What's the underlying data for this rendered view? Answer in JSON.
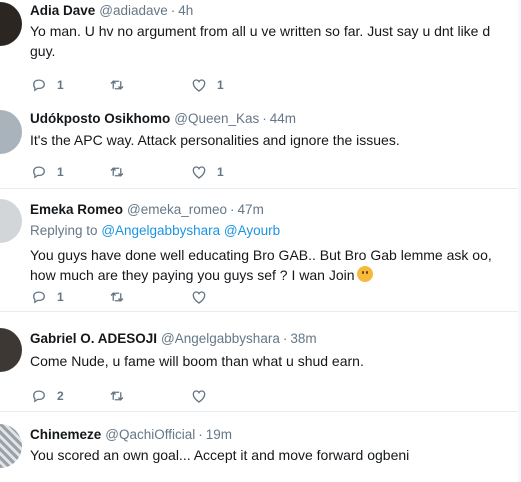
{
  "tweets": [
    {
      "name": "Adia Dave",
      "handle": "@adiadave",
      "time": "4h",
      "reply_label": "",
      "reply_mentions": [],
      "text": "Yo man.  U hv no argument from all u ve written so far. Just say u dnt like d guy.",
      "reply_count": "1",
      "retweet_count": "",
      "like_count": "1"
    },
    {
      "name": "Udókposto Osikhomo",
      "handle": "@Queen_Kas",
      "time": "44m",
      "reply_label": "",
      "reply_mentions": [],
      "text": "It's the APC way. Attack personalities and ignore the issues.",
      "reply_count": "1",
      "retweet_count": "",
      "like_count": "1"
    },
    {
      "name": "Emeka Romeo",
      "handle": "@emeka_romeo",
      "time": "47m",
      "reply_label": "Replying to",
      "reply_mentions": [
        "@Angelgabbyshara",
        "@Ayourb"
      ],
      "text": "You guys have done well educating Bro GAB.. But Bro Gab lemme ask oo, how much are they paying you guys sef ? I wan Join",
      "reply_count": "1",
      "retweet_count": "",
      "like_count": ""
    },
    {
      "name": "Gabriel O. ADESOJI",
      "handle": "@Angelgabbyshara",
      "time": "38m",
      "reply_label": "",
      "reply_mentions": [],
      "text": "Come Nude, u fame will boom than what u shud earn.",
      "reply_count": "2",
      "retweet_count": "",
      "like_count": ""
    },
    {
      "name": "Chinemeze",
      "handle": "@QachiOfficial",
      "time": "19m",
      "reply_label": "",
      "reply_mentions": [],
      "text": "You scored an own goal... Accept it and move forward ogbeni",
      "reply_count": "",
      "retweet_count": "",
      "like_count": ""
    }
  ],
  "separator": "·",
  "icons": {
    "reply": "reply-icon",
    "retweet": "retweet-icon",
    "like": "heart-icon",
    "hug": "hugging-face-emoji"
  },
  "colors": {
    "name": "#14171a",
    "meta": "#657786",
    "link": "#1b95e0",
    "divider": "#e6ecf0"
  }
}
